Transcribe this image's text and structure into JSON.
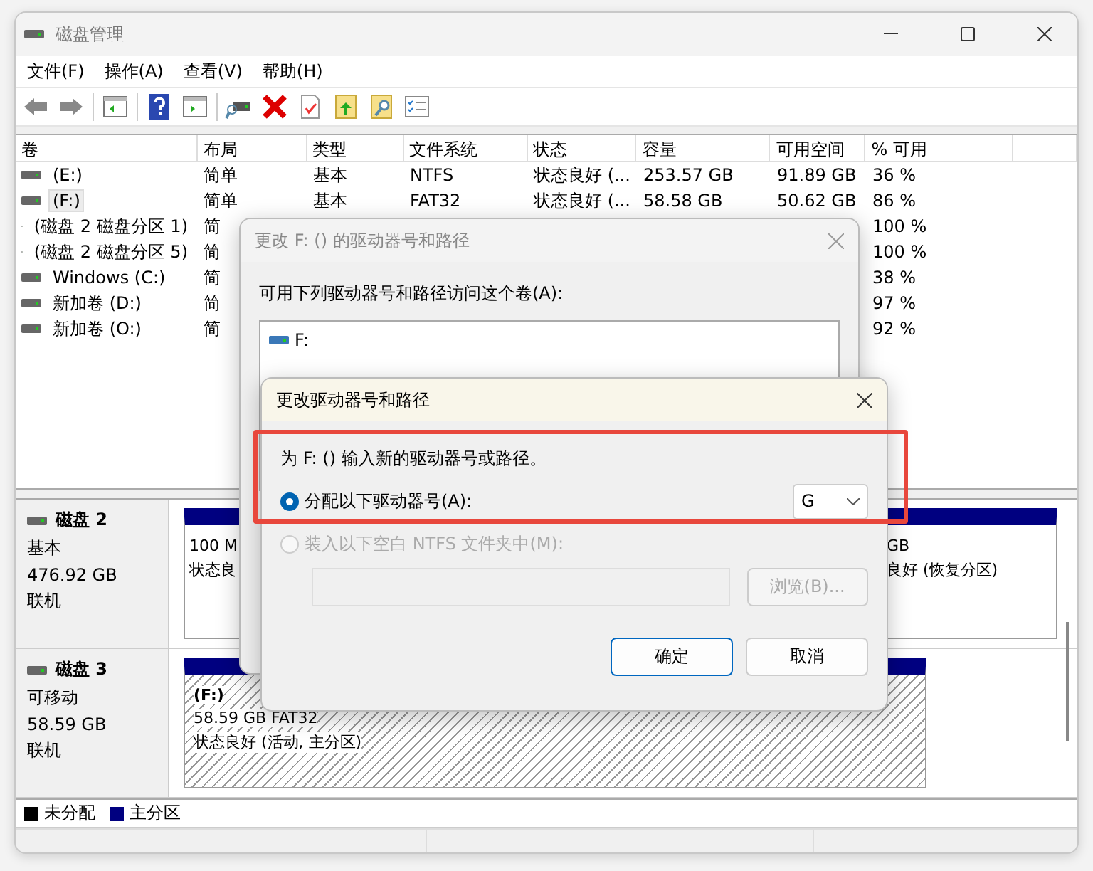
{
  "window": {
    "title": "磁盘管理",
    "menu": [
      "文件(F)",
      "操作(A)",
      "查看(V)",
      "帮助(H)"
    ]
  },
  "table": {
    "columns": [
      "卷",
      "布局",
      "类型",
      "文件系统",
      "状态",
      "容量",
      "可用空间",
      "% 可用"
    ],
    "rows": [
      {
        "volume": "(E:)",
        "layout": "简单",
        "type": "基本",
        "fs": "NTFS",
        "status": "状态良好 (...",
        "capacity": "253.57 GB",
        "free": "91.89 GB",
        "pct": "36 %",
        "selected": false
      },
      {
        "volume": "(F:)",
        "layout": "简单",
        "type": "基本",
        "fs": "FAT32",
        "status": "状态良好 (...",
        "capacity": "58.58 GB",
        "free": "50.62 GB",
        "pct": "86 %",
        "selected": true
      },
      {
        "volume": "(磁盘 2 磁盘分区 1)",
        "layout": "简",
        "pct": "100 %",
        "selected": false
      },
      {
        "volume": "(磁盘 2 磁盘分区 5)",
        "layout": "简",
        "pct": "100 %",
        "selected": false
      },
      {
        "volume": "Windows (C:)",
        "layout": "简",
        "pct": "38 %",
        "selected": false
      },
      {
        "volume": "新加卷 (D:)",
        "layout": "简",
        "pct": "97 %",
        "selected": false
      },
      {
        "volume": "新加卷 (O:)",
        "layout": "简",
        "pct": "92 %",
        "selected": false
      }
    ]
  },
  "disks": [
    {
      "name": "磁盘 2",
      "kind": "基本",
      "size": "476.92 GB",
      "state": "联机",
      "partitions": [
        {
          "lines": [
            "100 M",
            "状态良"
          ],
          "selected": false
        },
        {
          "lines": [
            "GB",
            "良好 (恢复分区)"
          ],
          "selected": false
        }
      ]
    },
    {
      "name": "磁盘 3",
      "kind": "可移动",
      "size": "58.59 GB",
      "state": "联机",
      "partitions": [
        {
          "lines": [
            "(F:)",
            "58.59 GB FAT32",
            "状态良好 (活动, 主分区)"
          ],
          "selected": true
        }
      ]
    }
  ],
  "legend": [
    {
      "label": "未分配",
      "color": "#000000"
    },
    {
      "label": "主分区",
      "color": "#000080"
    }
  ],
  "path_dialog": {
    "title": "更改 F: () 的驱动器号和路径",
    "active": false,
    "prompt": "可用下列驱动器号和路径访问这个卷(A):",
    "entries": [
      "F:"
    ]
  },
  "letter_dialog": {
    "title": "更改驱动器号和路径",
    "active": true,
    "prompt": "为 F: () 输入新的驱动器号或路径。",
    "options": [
      {
        "label": "分配以下驱动器号(A):",
        "selected": true,
        "disabled": false,
        "kind": "letter"
      },
      {
        "label": "装入以下空白 NTFS 文件夹中(M):",
        "selected": false,
        "disabled": true,
        "kind": "folder"
      }
    ],
    "letter": "G",
    "browse": {
      "label": "浏览(B)...",
      "disabled": true
    },
    "buttons": [
      "确定",
      "取消"
    ]
  }
}
